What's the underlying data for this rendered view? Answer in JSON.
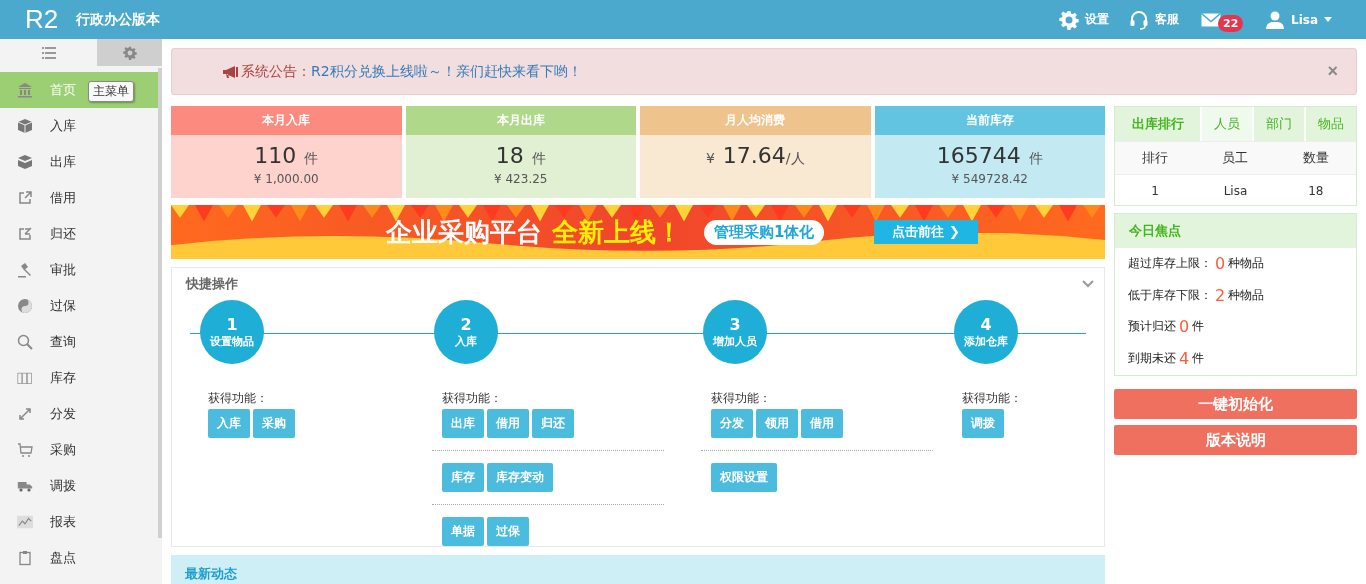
{
  "header": {
    "logo": "R2",
    "product": "行政办公版本",
    "settings": "设置",
    "service": "客服",
    "mail_count": "22",
    "user": "Lisa"
  },
  "sidebar": {
    "tooltip": "主菜单",
    "items": [
      {
        "label": "首页",
        "selected": true
      },
      {
        "label": "入库",
        "selected": false
      },
      {
        "label": "出库",
        "selected": false
      },
      {
        "label": "借用",
        "selected": false
      },
      {
        "label": "归还",
        "selected": false
      },
      {
        "label": "审批",
        "selected": false
      },
      {
        "label": "过保",
        "selected": false
      },
      {
        "label": "查询",
        "selected": false
      },
      {
        "label": "库存",
        "selected": false
      },
      {
        "label": "分发",
        "selected": false
      },
      {
        "label": "采购",
        "selected": false
      },
      {
        "label": "调拨",
        "selected": false
      },
      {
        "label": "报表",
        "selected": false
      },
      {
        "label": "盘点",
        "selected": false
      }
    ]
  },
  "notice": {
    "label": "系统公告：",
    "message": "R2积分兑换上线啦～！亲们赶快来看下哟！",
    "close": "×"
  },
  "stats": [
    {
      "title": "本月入库",
      "value": "110",
      "unit": "件",
      "amount": "¥  1,000.00",
      "color": "#fd8a7e"
    },
    {
      "title": "本月出库",
      "value": "18",
      "unit": "件",
      "amount": "¥  423.25",
      "color": "#b0d88b"
    },
    {
      "title": "月人均消费",
      "prefix": "¥",
      "value": "17.64",
      "unit": "/人",
      "color": "#eec48c"
    },
    {
      "title": "当前库存",
      "value": "165744",
      "unit": "件",
      "amount": "¥  549728.42",
      "color": "#62c4e0"
    }
  ],
  "banner": {
    "headline": "企业采购平台",
    "highlight": "全新上线！",
    "tagline": "管理采购1体化",
    "cta": "点击前往 ❯"
  },
  "quick_ops": {
    "title": "快捷操作",
    "steps": [
      {
        "number": "1",
        "title": "设置物品",
        "features_label": "获得功能：",
        "groups": [
          [
            "入库",
            "采购"
          ]
        ]
      },
      {
        "number": "2",
        "title": "入库",
        "features_label": "获得功能：",
        "groups": [
          [
            "出库",
            "借用",
            "归还"
          ],
          [
            "库存",
            "库存变动"
          ],
          [
            "单据",
            "过保"
          ]
        ]
      },
      {
        "number": "3",
        "title": "增加人员",
        "features_label": "获得功能：",
        "groups": [
          [
            "分发",
            "领用",
            "借用"
          ],
          [
            "权限设置"
          ]
        ]
      },
      {
        "number": "4",
        "title": "添加仓库",
        "features_label": "获得功能：",
        "groups": [
          [
            "调拨"
          ]
        ]
      }
    ]
  },
  "news": {
    "title": "最新动态"
  },
  "ranking": {
    "title": "出库排行",
    "tabs": [
      {
        "label": "人员",
        "selected": true
      },
      {
        "label": "部门",
        "selected": false
      },
      {
        "label": "物品",
        "selected": false
      }
    ],
    "columns": [
      "排行",
      "员工",
      "数量"
    ],
    "rows": [
      [
        "1",
        "Lisa",
        "18"
      ]
    ]
  },
  "focus": {
    "title": "今日焦点",
    "lines": [
      {
        "label": "超过库存上限：",
        "count": "0",
        "unit": "种物品"
      },
      {
        "label": "低于库存下限：",
        "count": "2",
        "unit": "种物品"
      },
      {
        "label": "预计归还",
        "count": "0",
        "unit": "件"
      },
      {
        "label": "到期未还",
        "count": "4",
        "unit": "件"
      }
    ]
  },
  "actions": [
    "一键初始化",
    "版本说明"
  ]
}
